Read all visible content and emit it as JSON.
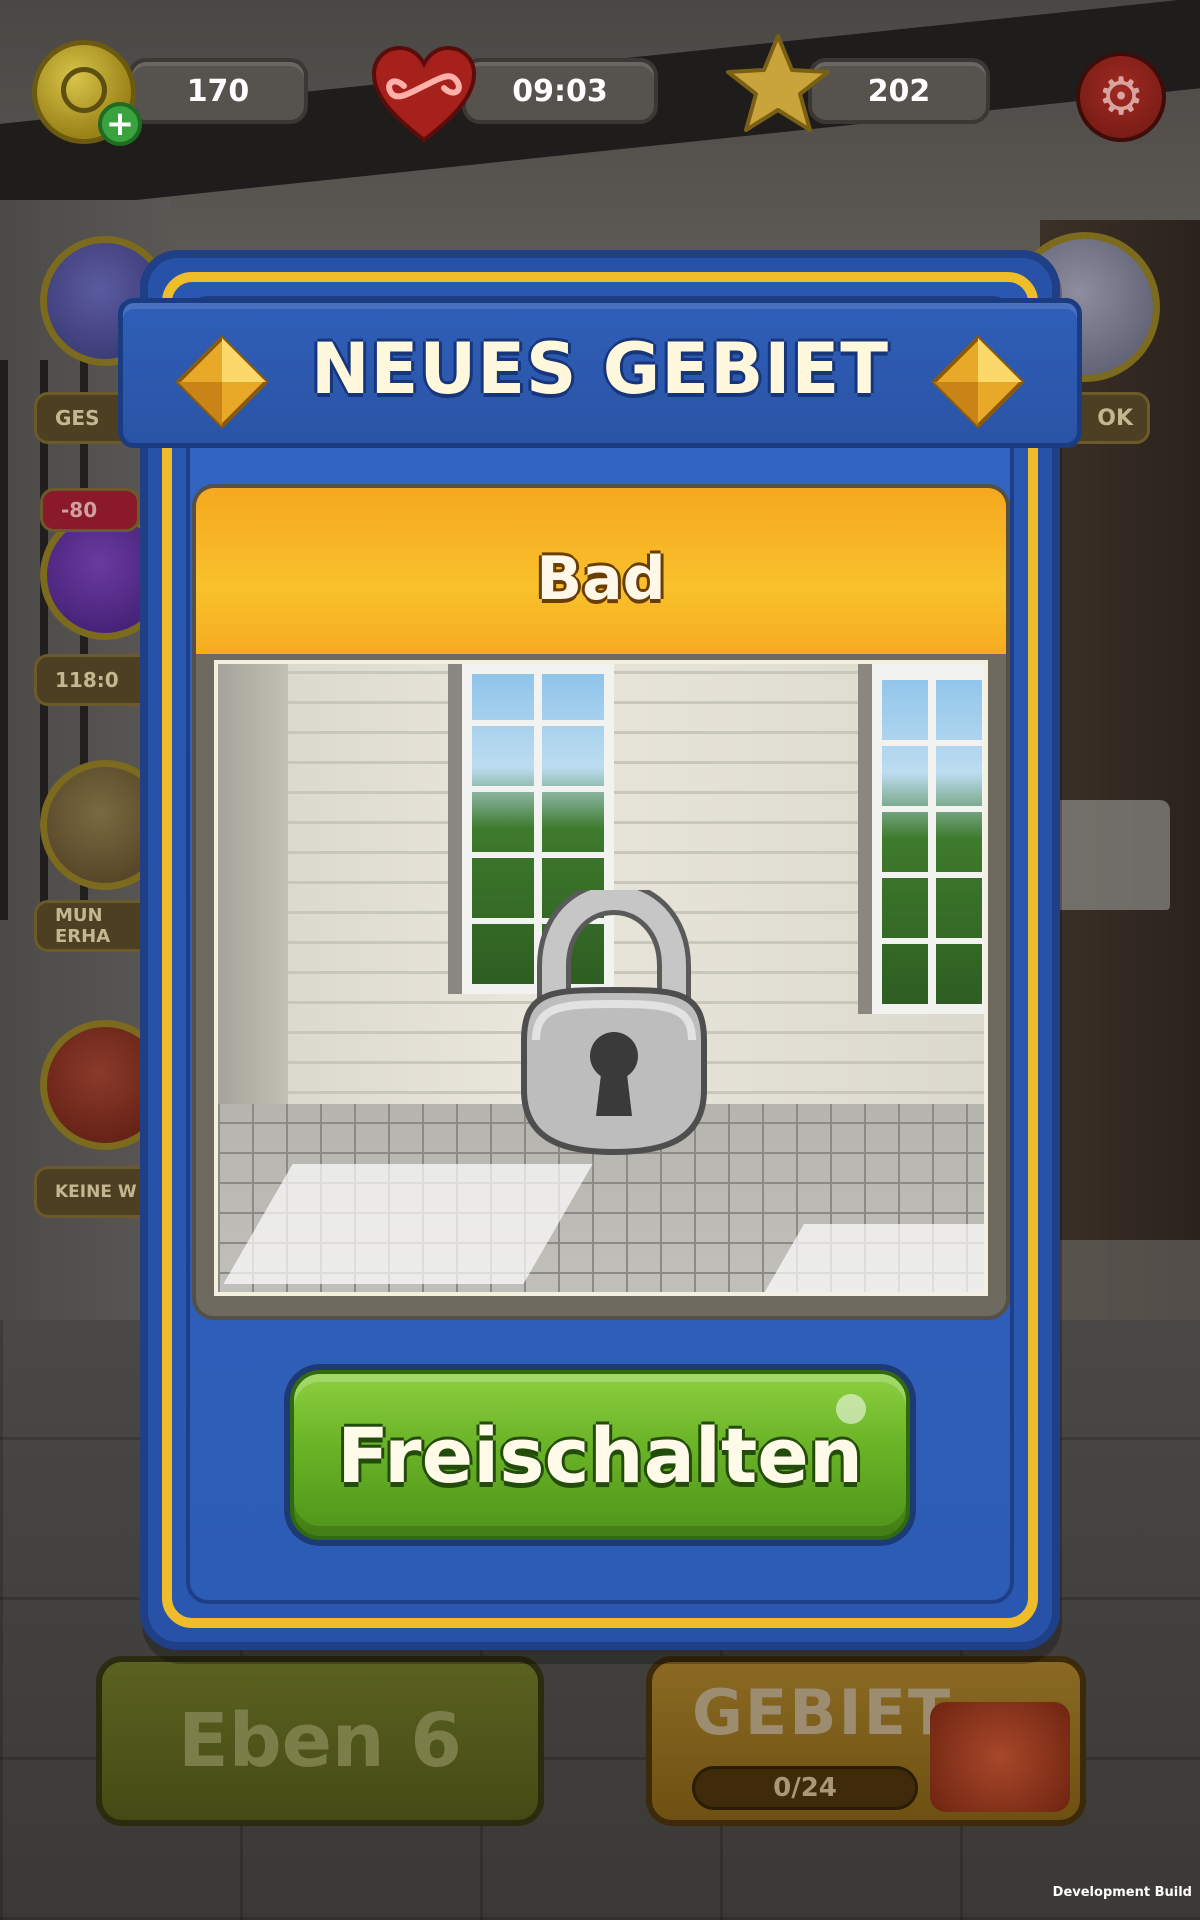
{
  "hud": {
    "coins": "170",
    "lives_timer": "09:03",
    "stars": "202"
  },
  "side_menu": {
    "left_labels": [
      "GES",
      "118:0",
      "MUN ERHA",
      "KEINE W"
    ],
    "left_badge": "-80",
    "right_label": "OK"
  },
  "modal": {
    "title": "NEUES GEBIET",
    "room_name": "Bad",
    "unlock_label": "Freischalten"
  },
  "bottom": {
    "level_label": "Eben 6",
    "area_title": "GEBIET",
    "area_progress_text": "0/24",
    "area_progress": 0
  },
  "footer": {
    "build_label": "Development Build"
  },
  "icons": {
    "coin": "clock-coin-icon",
    "add": "plus-icon",
    "lives": "infinity-heart-icon",
    "stars": "star-icon",
    "settings": "gear-icon",
    "lock": "padlock-icon",
    "gem": "diamond-gem-icon"
  },
  "colors": {
    "modal_blue": "#2d5cb6",
    "modal_gold": "#f0bd2a",
    "header_orange": "#f9c12c",
    "button_green": "#6ab326"
  }
}
